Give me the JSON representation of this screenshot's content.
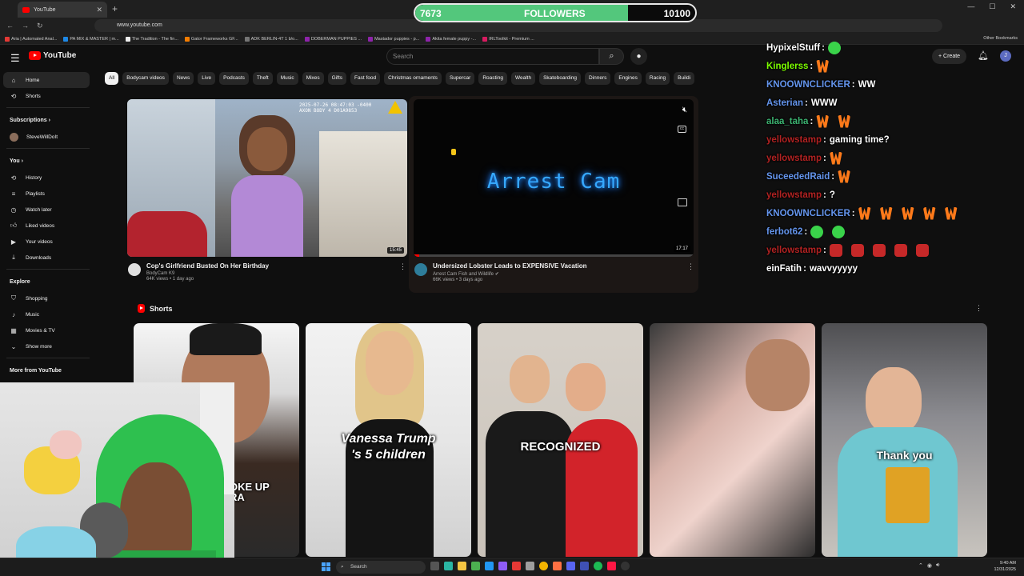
{
  "browser": {
    "tab_title": "YouTube",
    "url": "www.youtube.com",
    "bookmarks": [
      "Aria | Automated Anal...",
      "PA MIX & MASTER | m...",
      "The Tradition - The fin...",
      "Gator Frameworks GF...",
      "ADK BERLIN-4T 1 b/o...",
      "DOBERMAN PUPPIES ...",
      "Mastador puppies - p...",
      "Akita female puppy -...",
      "IRLToolkit - Premium ..."
    ],
    "other_bookmarks": "Other Bookmarks"
  },
  "followers": {
    "current": "7673",
    "label": "FOLLOWERS",
    "goal": "10100",
    "progress_fraction": 0.76
  },
  "youtube": {
    "logo_text": "YouTube",
    "search_placeholder": "Search",
    "create_label": "Create",
    "avatar_letter": "J",
    "chips": [
      "All",
      "Bodycam videos",
      "News",
      "Live",
      "Podcasts",
      "Theft",
      "Music",
      "Mixes",
      "Gifts",
      "Fast food",
      "Christmas ornaments",
      "Supercar",
      "Roasting",
      "Wealth",
      "Skateboarding",
      "Dinners",
      "Engines",
      "Racing",
      "Buildi"
    ],
    "sidebar": {
      "home": "Home",
      "shorts": "Shorts",
      "subscriptions": "Subscriptions",
      "sub_channel": "SteveWillDoIt",
      "you": "You",
      "history": "History",
      "playlists": "Playlists",
      "watch_later": "Watch later",
      "liked": "Liked videos",
      "your_videos": "Your videos",
      "downloads": "Downloads",
      "explore": "Explore",
      "shopping": "Shopping",
      "music": "Music",
      "movies": "Movies & TV",
      "show_more": "Show more",
      "more_from": "More from YouTube"
    },
    "videos": [
      {
        "title": "Cop's Girlfriend Busted On Her Birthday",
        "channel": "BodyCam K9",
        "meta": "64K views • 1 day ago",
        "duration": "15:45",
        "timestamp_overlay": "2025-07-26 08:47:03 -0400\nAXON BODY 4 D01A9853"
      },
      {
        "title": "Undersized Lobster Leads to EXPENSIVE Vacation",
        "channel": "Arrest Cam Fish and Wildlife",
        "meta": "66K views • 3 days ago",
        "duration": "17:17",
        "player_text": "Arrest Cam"
      }
    ],
    "shorts_label": "Shorts",
    "shorts_captions": [
      "OKE UP\nRA",
      "Vanessa Trump\n's 5 children",
      "RECOGNIZED",
      "",
      "Thank you"
    ]
  },
  "chat": [
    {
      "user": "HypixelStuff",
      "color": "#ffffff",
      "msg": "",
      "emotes": [
        "frog"
      ]
    },
    {
      "user": "Kinglerss",
      "color": "#7CFC00",
      "msg": "",
      "emotes": [
        "w"
      ]
    },
    {
      "user": "KNOOWNCLICKER",
      "color": "#6495ED",
      "msg": "WW",
      "emotes": []
    },
    {
      "user": "Asterian",
      "color": "#6495ED",
      "msg": "WWW",
      "emotes": []
    },
    {
      "user": "alaa_taha",
      "color": "#3CB371",
      "msg": "",
      "emotes": [
        "w",
        "w"
      ]
    },
    {
      "user": "yellowstamp",
      "color": "#B22222",
      "msg": "gaming time?",
      "emotes": []
    },
    {
      "user": "yellowstamp",
      "color": "#B22222",
      "msg": "",
      "emotes": [
        "w"
      ]
    },
    {
      "user": "SuceededRaid",
      "color": "#6495ED",
      "msg": "",
      "emotes": [
        "w"
      ]
    },
    {
      "user": "yellowstamp",
      "color": "#B22222",
      "msg": "?",
      "emotes": []
    },
    {
      "user": "KNOOWNCLICKER",
      "color": "#6495ED",
      "msg": "",
      "emotes": [
        "w",
        "w",
        "w",
        "w",
        "w"
      ]
    },
    {
      "user": "ferbot62",
      "color": "#6495ED",
      "msg": "",
      "emotes": [
        "frog",
        "frog"
      ]
    },
    {
      "user": "yellowstamp",
      "color": "#B22222",
      "msg": "",
      "emotes": [
        "angry",
        "angry",
        "angry",
        "angry",
        "angry"
      ]
    },
    {
      "user": "einFatih",
      "color": "#ffffff",
      "msg": "wavvyyyyy",
      "emotes": []
    }
  ],
  "taskbar": {
    "search_label": "Search",
    "time": "9:40 AM",
    "date": "12/31/2025"
  }
}
